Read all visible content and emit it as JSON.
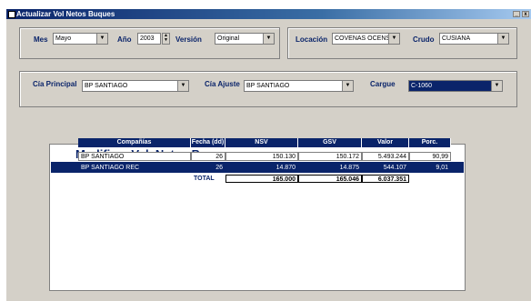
{
  "window": {
    "title": "Actualizar Vol Netos Buques"
  },
  "filters": {
    "mes": {
      "label": "Mes",
      "value": "Mayo"
    },
    "anio": {
      "label": "Año",
      "value": "2003"
    },
    "version": {
      "label": "Versión",
      "value": "Original"
    },
    "locacion": {
      "label": "Locación",
      "value": "COVENAS OCENSA"
    },
    "crudo": {
      "label": "Crudo",
      "value": "CUSIANA"
    },
    "cia_principal": {
      "label": "Cía Principal",
      "value": "BP SANTIAGO"
    },
    "cia_ajuste": {
      "label": "Cía Ajuste",
      "value": "BP SANTIAGO"
    },
    "cargue": {
      "label": "Cargue",
      "value": "C-1060"
    }
  },
  "grid": {
    "title": "Modificar Vol. Netos Buques",
    "headers": [
      "Compañías",
      "Fecha (dd)",
      "NSV",
      "GSV",
      "Valor",
      "Porc."
    ],
    "rows": [
      {
        "company": "BP SANTIAGO",
        "fecha": "26",
        "nsv": "150.130",
        "gsv": "150.172",
        "valor": "5.493.244",
        "porc": "90,99"
      },
      {
        "company": "BP SANTIAGO REC",
        "fecha": "26",
        "nsv": "14.870",
        "gsv": "14.875",
        "valor": "544.107",
        "porc": "9,01"
      }
    ],
    "total": {
      "label": "TOTAL",
      "nsv": "165.000",
      "gsv": "165.046",
      "valor": "6.037.351"
    }
  }
}
